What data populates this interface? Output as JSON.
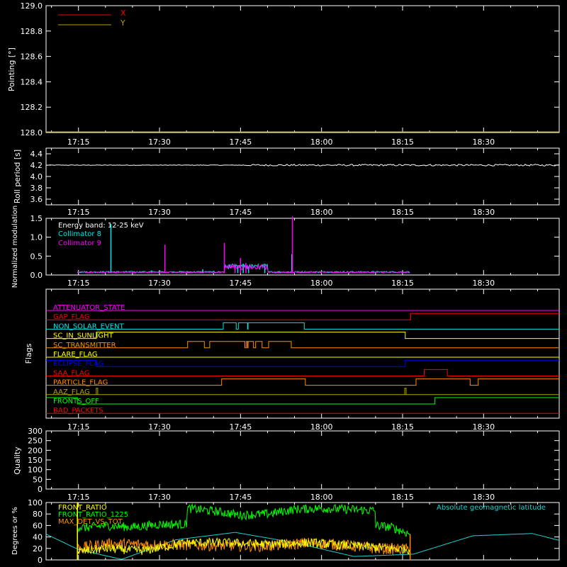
{
  "time_axis": {
    "ticks": [
      "17:15",
      "17:30",
      "17:45",
      "18:00",
      "18:15",
      "18:30"
    ],
    "tick_minutes": [
      1035,
      1050,
      1065,
      1080,
      1095,
      1110
    ],
    "range_minutes": [
      1029,
      1124
    ]
  },
  "data_window": {
    "start_minutes": 1034.8,
    "end_minutes": 1096.4
  },
  "colors": {
    "white": "#ffffff",
    "red": "#ff0000",
    "olive": "#b3a000",
    "cyan": "#00e5e5",
    "magenta": "#ff00ff",
    "yellow": "#ffff00",
    "orange": "#ff8c00",
    "blue": "#0000ff",
    "green": "#00ff00",
    "rate_cyan": "#20d0d0"
  },
  "chart_data": [
    {
      "type": "line",
      "panel": "pointing",
      "ylabel": "Pointing [°]",
      "ylim": [
        128.0,
        129.0
      ],
      "yticks": [
        "128.0",
        "128.2",
        "128.4",
        "128.6",
        "128.8",
        "129.0"
      ],
      "series": [
        {
          "name": "X",
          "color": "#ff0000",
          "values": []
        },
        {
          "name": "Y",
          "color": "#b3a000",
          "values": []
        }
      ]
    },
    {
      "type": "line",
      "panel": "roll",
      "ylabel": "Roll period [s]",
      "ylim": [
        3.5,
        4.5
      ],
      "yticks": [
        "3.6",
        "3.8",
        "4.0",
        "4.2",
        "4.4"
      ],
      "series": [
        {
          "color": "#ffffff",
          "x": [
            1029,
            1124
          ],
          "values": [
            4.2,
            4.2
          ]
        }
      ]
    },
    {
      "type": "line",
      "panel": "modulation",
      "ylabel": "Normalized modulation",
      "ylim": [
        0,
        1.5
      ],
      "yticks": [
        "0.0",
        "0.5",
        "1.0",
        "1.5"
      ],
      "legend_title": "Energy band: 12-25 keV",
      "series": [
        {
          "name": "Collimator 8",
          "color": "#00e5e5",
          "baseline": 0.06,
          "spikes": [
            [
              1041.0,
              1.35
            ],
            [
              1048.5,
              0.12
            ],
            [
              1058.0,
              0.15
            ],
            [
              1064.5,
              0.25
            ],
            [
              1065.5,
              0.3
            ],
            [
              1066.5,
              0.22
            ],
            [
              1069.5,
              0.3
            ],
            [
              1074.5,
              0.55
            ]
          ]
        },
        {
          "name": "Collimator 9",
          "color": "#ff00ff",
          "baseline": 0.05,
          "spikes": [
            [
              1051.0,
              0.8
            ],
            [
              1062.0,
              0.85
            ],
            [
              1064.0,
              0.28
            ],
            [
              1065.0,
              0.45
            ],
            [
              1066.0,
              0.32
            ],
            [
              1074.6,
              1.55
            ]
          ]
        }
      ]
    },
    {
      "type": "line",
      "panel": "flags",
      "ylabel": "Flags",
      "series": [
        {
          "name": "ATTENUATOR_STATE",
          "color": "#ff00ff",
          "segments": [
            [
              1029,
              0
            ]
          ]
        },
        {
          "name": "GAP_FLAG",
          "color": "#ff0000",
          "segments": [
            [
              1029,
              0
            ],
            [
              1096.5,
              1
            ],
            [
              1126,
              1
            ]
          ],
          "blips": [
            1126.5
          ]
        },
        {
          "name": "NON_SOLAR_EVENT",
          "color": "#00e5e5",
          "segments": [
            [
              1029,
              0
            ],
            [
              1061.8,
              1
            ],
            [
              1066.3,
              0
            ],
            [
              1066.4,
              1
            ],
            [
              1076.8,
              0
            ]
          ],
          "dips": [
            [
              1064.2,
              1064.6
            ]
          ]
        },
        {
          "name": "SC_IN_SUNLIGHT",
          "color": "#ffff00",
          "segments": [
            [
              1029,
              0
            ],
            [
              1038.3,
              1
            ],
            [
              1095.5,
              0
            ]
          ]
        },
        {
          "name": "SC_TRANSMITTER",
          "color": "#ff8c00",
          "segments": [
            [
              1029,
              0
            ],
            [
              1055.2,
              1
            ],
            [
              1058.3,
              0
            ],
            [
              1059.3,
              1
            ],
            [
              1066.3,
              0
            ],
            [
              1066.4,
              1
            ],
            [
              1069.0,
              0
            ],
            [
              1070.2,
              1
            ],
            [
              1074.4,
              0
            ]
          ],
          "dips": [
            [
              1065.8,
              1066.1
            ],
            [
              1067.4,
              1067.8
            ]
          ]
        },
        {
          "name": "FLARE_FLAG",
          "color": "#ffff00",
          "segments": [
            [
              1029,
              0
            ]
          ]
        },
        {
          "name": "ECLIPSE_FLAG",
          "color": "#0000ff",
          "segments": [
            [
              1029,
              1
            ],
            [
              1038.3,
              0
            ],
            [
              1095.5,
              1
            ]
          ]
        },
        {
          "name": "SAA_FLAG",
          "color": "#ff0000",
          "segments": [
            [
              1029,
              0
            ],
            [
              1099.0,
              1
            ],
            [
              1103.3,
              0
            ]
          ]
        },
        {
          "name": "PARTICLE_FLAG",
          "color": "#ff8c00",
          "segments": [
            [
              1029,
              0
            ],
            [
              1061.5,
              1
            ],
            [
              1077.0,
              0
            ],
            [
              1097.5,
              1
            ],
            [
              1107.5,
              0
            ],
            [
              1109.0,
              1
            ]
          ]
        },
        {
          "name": "AAZ_FLAG",
          "color": "#b3a000",
          "segments": [
            [
              1029,
              0
            ]
          ],
          "blips": [
            1038.3,
            1095.4
          ]
        },
        {
          "name": "FRONTS_OFF",
          "color": "#00ff00",
          "segments": [
            [
              1029,
              1
            ],
            [
              1034.8,
              0
            ],
            [
              1101.0,
              1
            ]
          ]
        },
        {
          "name": "BAD_PACKETS",
          "color": "#ff0000",
          "segments": [
            [
              1029,
              0
            ]
          ]
        }
      ]
    },
    {
      "type": "line",
      "panel": "quality",
      "ylabel": "Quality",
      "ylim": [
        0,
        300
      ],
      "yticks": [
        "0",
        "50",
        "100",
        "150",
        "200",
        "250",
        "300"
      ],
      "series": []
    },
    {
      "type": "line",
      "panel": "rates",
      "ylabel": "Degrees or %",
      "ylim": [
        0,
        100
      ],
      "yticks": [
        "0",
        "20",
        "40",
        "60",
        "80",
        "100"
      ],
      "annotation": "Absolute geomagnetic latitude",
      "series": [
        {
          "name": "FRONT_RATIO",
          "color": "#ffff00",
          "x": [
            1034.8,
            1040,
            1047,
            1055,
            1062,
            1070,
            1078,
            1085,
            1090,
            1096.4
          ],
          "values": [
            14,
            20,
            16,
            30,
            30,
            27,
            30,
            25,
            22,
            18
          ]
        },
        {
          "name": "FRONT_RATIO_1225",
          "color": "#00ff00",
          "x": [
            1034.8,
            1036,
            1040,
            1045,
            1050,
            1055,
            1055.1,
            1060,
            1065,
            1070,
            1075,
            1080,
            1085,
            1089.9,
            1090,
            1093,
            1096.4
          ],
          "values": [
            58,
            56,
            60,
            57,
            62,
            62,
            90,
            85,
            78,
            80,
            88,
            90,
            88,
            86,
            60,
            57,
            45
          ]
        },
        {
          "name": "MAX_DET_VS_TOT",
          "color": "#ff8c00",
          "x": [
            1034.8,
            1040,
            1047,
            1055,
            1062,
            1070,
            1078,
            1085,
            1090,
            1096.4
          ],
          "values": [
            20,
            28,
            27,
            26,
            25,
            24,
            30,
            25,
            20,
            18
          ]
        },
        {
          "name": "",
          "color": "#20d0d0",
          "x": [
            1029,
            1035,
            1043,
            1053,
            1064,
            1075,
            1086,
            1097,
            1108,
            1119,
            1124
          ],
          "values": [
            45,
            18,
            1,
            35,
            48,
            30,
            6,
            10,
            42,
            46,
            34
          ]
        }
      ]
    }
  ]
}
